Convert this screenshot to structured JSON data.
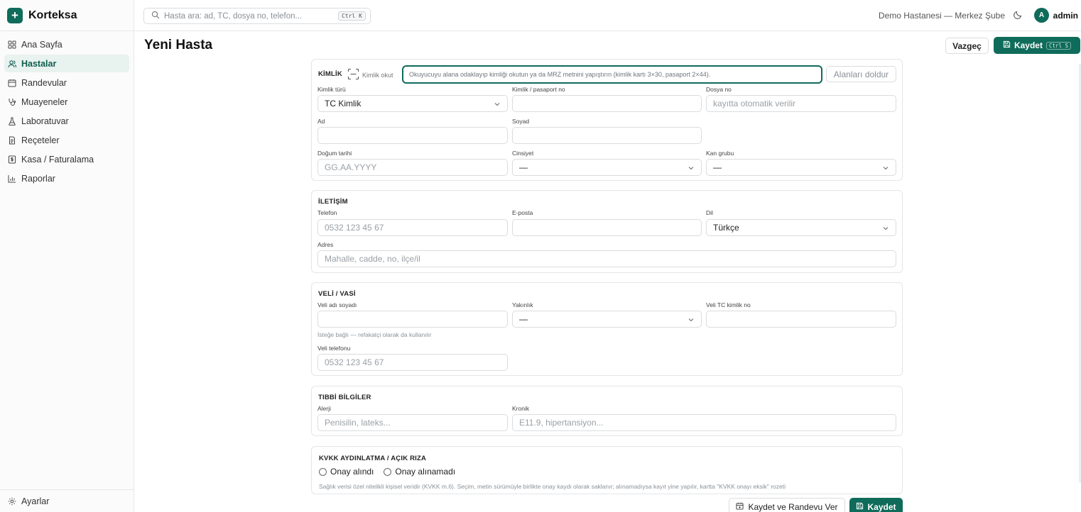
{
  "app": {
    "name": "Korteksa"
  },
  "sidebar": {
    "items": [
      {
        "label": "Ana Sayfa",
        "icon": "grid-icon"
      },
      {
        "label": "Hastalar",
        "icon": "users-icon"
      },
      {
        "label": "Randevular",
        "icon": "calendar-icon"
      },
      {
        "label": "Muayeneler",
        "icon": "stethoscope-icon"
      },
      {
        "label": "Laboratuvar",
        "icon": "flask-icon"
      },
      {
        "label": "Reçeteler",
        "icon": "prescription-icon"
      },
      {
        "label": "Kasa / Faturalama",
        "icon": "receipt-icon"
      },
      {
        "label": "Raporlar",
        "icon": "bar-chart-icon"
      }
    ],
    "active": "Hastalar",
    "settings_label": "Ayarlar"
  },
  "topbar": {
    "search_placeholder": "Hasta ara: ad, TC, dosya no, telefon...",
    "search_shortcut": "Ctrl K",
    "branch": "Demo Hastanesi — Merkez Şube",
    "avatar_initial": "A",
    "username": "admin"
  },
  "page": {
    "title": "Yeni Hasta",
    "cancel_label": "Vazgeç",
    "save_label": "Kaydet",
    "save_shortcut": "Ctrl S"
  },
  "kimlik": {
    "title": "KİMLİK",
    "scan_label": "Kimlik okut",
    "mrz_placeholder": "Okuyucuyu alana odaklayıp kimliği okutun ya da MRZ metnini yapıştırın (kimlik kartı 3×30, pasaport 2×44).",
    "fill_button": "Alanları doldur",
    "kimlik_turu_label": "Kimlik türü",
    "kimlik_turu_value": "TC Kimlik",
    "kimlik_no_label": "Kimlik / pasaport no",
    "dosya_no_label": "Dosya no",
    "dosya_no_placeholder": "kayıtta otomatik verilir",
    "ad_label": "Ad",
    "soyad_label": "Soyad",
    "dogum_label": "Doğum tarihi",
    "dogum_placeholder": "GG.AA.YYYY",
    "cinsiyet_label": "Cinsiyet",
    "cinsiyet_value": "—",
    "kan_label": "Kan grubu",
    "kan_value": "—"
  },
  "iletisim": {
    "title": "İLETİŞİM",
    "telefon_label": "Telefon",
    "telefon_placeholder": "0532 123 45 67",
    "eposta_label": "E-posta",
    "dil_label": "Dil",
    "dil_value": "Türkçe",
    "adres_label": "Adres",
    "adres_placeholder": "Mahalle, cadde, no, ilçe/il"
  },
  "veli": {
    "title": "VELİ / VASİ",
    "ad_label": "Veli adı soyadı",
    "ad_hint": "İsteğe bağlı — refakatçi olarak da kullanılır",
    "yakinlik_label": "Yakınlık",
    "yakinlik_value": "—",
    "tc_label": "Veli TC kimlik no",
    "telefon_label": "Veli telefonu",
    "telefon_placeholder": "0532 123 45 67"
  },
  "tibbi": {
    "title": "TIBBİ BİLGİLER",
    "alerji_label": "Alerji",
    "alerji_placeholder": "Penisilin, lateks...",
    "kronik_label": "Kronik",
    "kronik_placeholder": "E11.9, hipertansiyon..."
  },
  "kvkk": {
    "title": "KVKK AYDINLATMA / AÇIK RIZA",
    "option_yes": "Onay alındı",
    "option_no": "Onay alınamadı",
    "note": "Sağlık verisi özel nitelikli kişisel veridir (KVKK m.6). Seçim, metin sürümüyle birlikte onay kaydı olarak saklanır; alınamadıysa kayıt yine yapılır, kartta \"KVKK onayı eksik\" rozeti"
  },
  "footer": {
    "save_and_appt_label": "Kaydet ve Randevu Ver",
    "save_label": "Kaydet"
  },
  "colors": {
    "accent": "#0f6b5a",
    "active_bg": "#e8f2ef"
  }
}
